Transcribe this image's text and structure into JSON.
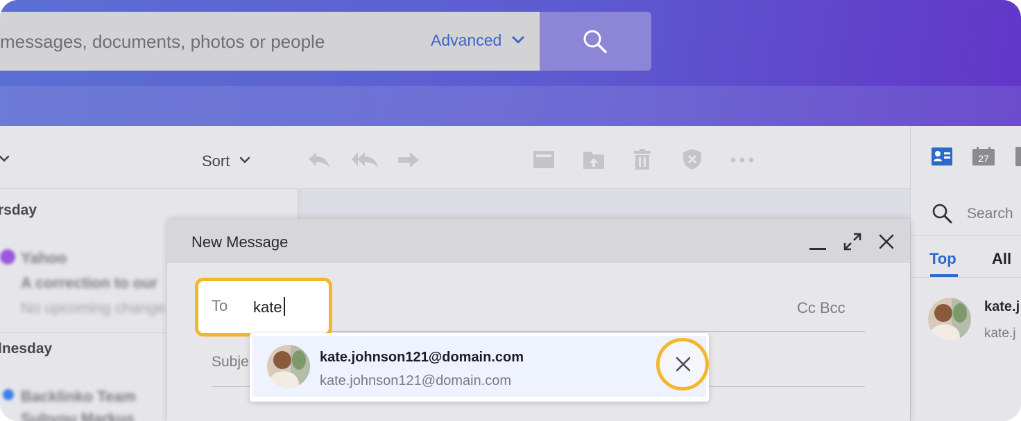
{
  "search": {
    "placeholder": "messages, documents, photos or people",
    "advanced_label": "Advanced"
  },
  "toolbar": {
    "sort_label": "Sort"
  },
  "message_list": {
    "day_1": "rsday",
    "day_2": "lnesday",
    "blurred_items": [
      {
        "sender": "Yahoo",
        "subject": "A correction to our",
        "preview": "No upcoming change"
      },
      {
        "sender": "Backlinko Team",
        "subject": "Subyou Markus"
      }
    ]
  },
  "right_panel": {
    "calendar_day": "27",
    "search_placeholder": "Search",
    "tab_top": "Top",
    "tab_all": "All",
    "contact_name": "kate.j",
    "contact_email": "kate.j"
  },
  "compose": {
    "title": "New Message",
    "to_label": "To",
    "to_value": "kate",
    "cc_bcc_label": "Cc Bcc",
    "subject_label": "Subje"
  },
  "suggestion": {
    "name": "kate.johnson121@domain.com",
    "email": "kate.johnson121@domain.com"
  },
  "colors": {
    "accent": "#3c66c9",
    "highlight": "#f3b72c",
    "header_start": "#5b6fd4",
    "header_end": "#6236c7"
  }
}
